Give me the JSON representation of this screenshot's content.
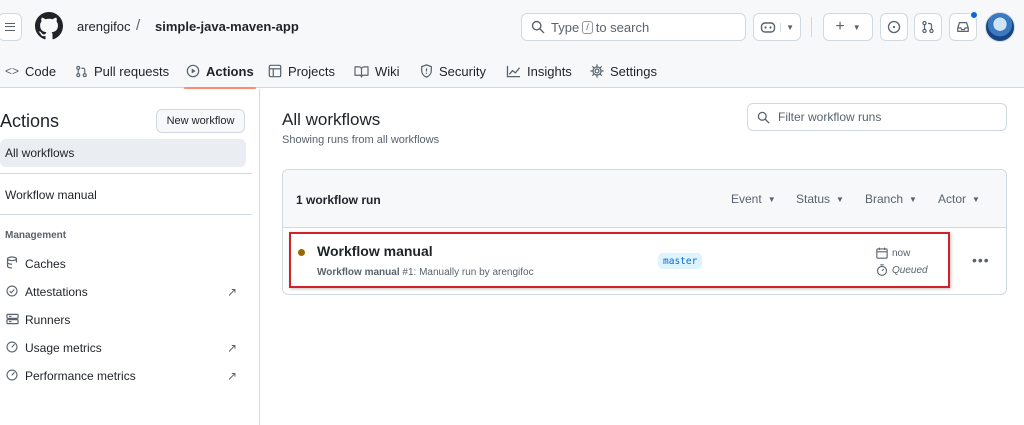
{
  "header": {
    "owner": "arengifoc",
    "separator": "/",
    "repo": "simple-java-maven-app",
    "search": {
      "prefix": "Type",
      "key": "/",
      "suffix": "to search"
    }
  },
  "repo_nav": {
    "tabs": [
      {
        "label": "Code",
        "icon": "code-icon"
      },
      {
        "label": "Pull requests",
        "icon": "git-pull-request-icon"
      },
      {
        "label": "Actions",
        "icon": "play-icon",
        "active": true
      },
      {
        "label": "Projects",
        "icon": "table-icon"
      },
      {
        "label": "Wiki",
        "icon": "book-icon"
      },
      {
        "label": "Security",
        "icon": "shield-icon"
      },
      {
        "label": "Insights",
        "icon": "graph-icon"
      },
      {
        "label": "Settings",
        "icon": "gear-icon"
      }
    ]
  },
  "sidebar": {
    "title": "Actions",
    "new_workflow": "New workflow",
    "all_workflows": "All workflows",
    "workflows": [
      "Workflow manual"
    ],
    "management_heading": "Management",
    "management_items": [
      {
        "label": "Caches",
        "icon": "cache-icon"
      },
      {
        "label": "Attestations",
        "icon": "check-circle-icon"
      },
      {
        "label": "Runners",
        "icon": "server-icon"
      },
      {
        "label": "Usage metrics",
        "icon": "meter-icon"
      },
      {
        "label": "Performance metrics",
        "icon": "meter-icon"
      }
    ]
  },
  "main": {
    "title": "All workflows",
    "subtitle": "Showing runs from all workflows",
    "filter_placeholder": "Filter workflow runs",
    "runs_count": "1 workflow run",
    "filters": [
      "Event",
      "Status",
      "Branch",
      "Actor"
    ],
    "run": {
      "title": "Workflow manual",
      "workflow_name": "Workflow manual",
      "run_number": "#1",
      "trigger": ": Manually run by arengifoc",
      "branch": "master",
      "time": "now",
      "status": "Queued"
    }
  },
  "colors": {
    "accent": "#fd8c73",
    "highlight_border": "#d0222a",
    "queued_dot": "#9a6700",
    "branch_bg": "#ddf4ff",
    "branch_fg": "#0969da"
  }
}
